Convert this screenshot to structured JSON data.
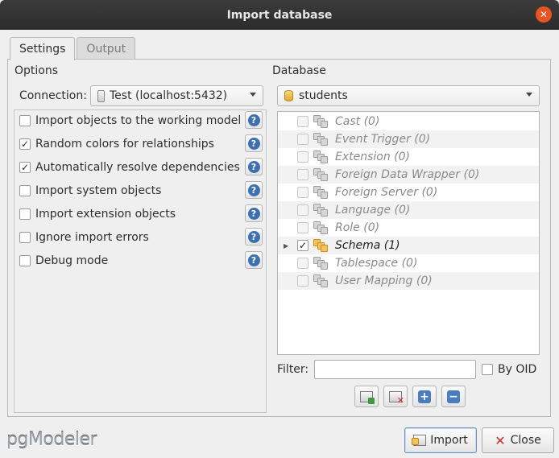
{
  "window": {
    "title": "Import database"
  },
  "tabs": [
    {
      "label": "Settings",
      "active": true
    },
    {
      "label": "Output",
      "active": false
    }
  ],
  "options": {
    "title": "Options",
    "connection_label": "Connection:",
    "connection_value": "Test (localhost:5432)",
    "items": [
      {
        "label": "Import objects to the working model",
        "checked": false,
        "check": ""
      },
      {
        "label": "Random colors for relationships",
        "checked": true,
        "check": "✓"
      },
      {
        "label": "Automatically resolve dependencies",
        "checked": true,
        "check": "✓"
      },
      {
        "label": "Import system objects",
        "checked": false,
        "check": ""
      },
      {
        "label": "Import extension objects",
        "checked": false,
        "check": ""
      },
      {
        "label": "Ignore import errors",
        "checked": false,
        "check": ""
      },
      {
        "label": "Debug mode",
        "checked": false,
        "check": ""
      }
    ],
    "help_glyph": "?"
  },
  "database": {
    "title": "Database",
    "selected": "students",
    "tree": [
      {
        "label": "Cast (0)",
        "enabled": false,
        "checked": false
      },
      {
        "label": "Event Trigger (0)",
        "enabled": false,
        "checked": false
      },
      {
        "label": "Extension (0)",
        "enabled": false,
        "checked": false
      },
      {
        "label": "Foreign Data Wrapper (0)",
        "enabled": false,
        "checked": false
      },
      {
        "label": "Foreign Server (0)",
        "enabled": false,
        "checked": false
      },
      {
        "label": "Language (0)",
        "enabled": false,
        "checked": false
      },
      {
        "label": "Role (0)",
        "enabled": false,
        "checked": false
      },
      {
        "label": "Schema (1)",
        "enabled": true,
        "checked": true
      },
      {
        "label": "Tablespace (0)",
        "enabled": false,
        "checked": false
      },
      {
        "label": "User Mapping (0)",
        "enabled": false,
        "checked": false
      }
    ],
    "filter_label": "Filter:",
    "filter_value": "",
    "by_oid_label": "By OID"
  },
  "footer": {
    "logo": "pgModeler",
    "import_label": "Import",
    "close_label": "Close"
  },
  "colors": {
    "titlebar": "#2c2c2c",
    "close": "#e95420",
    "help": "#3d6fb3",
    "schema": "#f2c45a"
  }
}
